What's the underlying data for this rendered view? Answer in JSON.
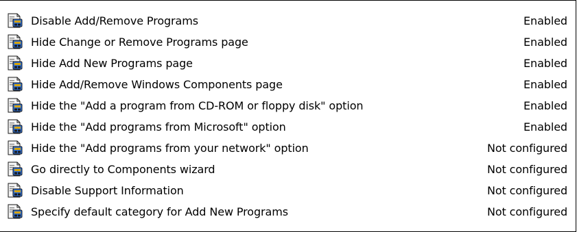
{
  "policies": [
    {
      "name": "Disable Add/Remove Programs",
      "state": "Enabled",
      "icon": "policy-setting-icon"
    },
    {
      "name": "Hide Change or Remove Programs page",
      "state": "Enabled",
      "icon": "policy-setting-icon"
    },
    {
      "name": "Hide Add New Programs page",
      "state": "Enabled",
      "icon": "policy-setting-icon"
    },
    {
      "name": "Hide Add/Remove Windows Components page",
      "state": "Enabled",
      "icon": "policy-setting-icon"
    },
    {
      "name": "Hide the \"Add a program from CD-ROM or floppy disk\" option",
      "state": "Enabled",
      "icon": "policy-setting-icon"
    },
    {
      "name": "Hide the \"Add programs from Microsoft\" option",
      "state": "Enabled",
      "icon": "policy-setting-icon"
    },
    {
      "name": "Hide the \"Add programs from your network\" option",
      "state": "Not configured",
      "icon": "policy-setting-icon"
    },
    {
      "name": "Go directly to Components wizard",
      "state": "Not configured",
      "icon": "policy-setting-icon"
    },
    {
      "name": "Disable Support Information",
      "state": "Not configured",
      "icon": "policy-setting-icon"
    },
    {
      "name": "Specify default category for Add New Programs",
      "state": "Not configured",
      "icon": "policy-setting-icon"
    }
  ],
  "colors": {
    "icon_paper": "#f3f3f3",
    "icon_blue": "#2f6fd1",
    "icon_dark": "#1a1a1a",
    "icon_gold": "#d9a400"
  }
}
